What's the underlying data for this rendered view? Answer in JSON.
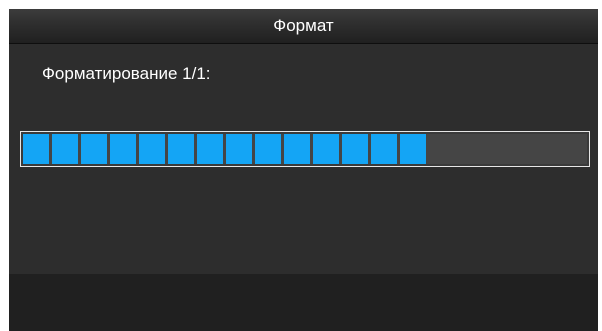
{
  "window": {
    "title": "Формат"
  },
  "status": {
    "text": "Форматирование 1/1:"
  },
  "progress": {
    "filled_segments": 14,
    "total_segments": 19,
    "fill_color": "#14a5f5",
    "track_color": "#454545"
  },
  "colors": {
    "dialog_background": "#2d2d2d",
    "footer_background": "#202020",
    "text": "#ffffff"
  }
}
